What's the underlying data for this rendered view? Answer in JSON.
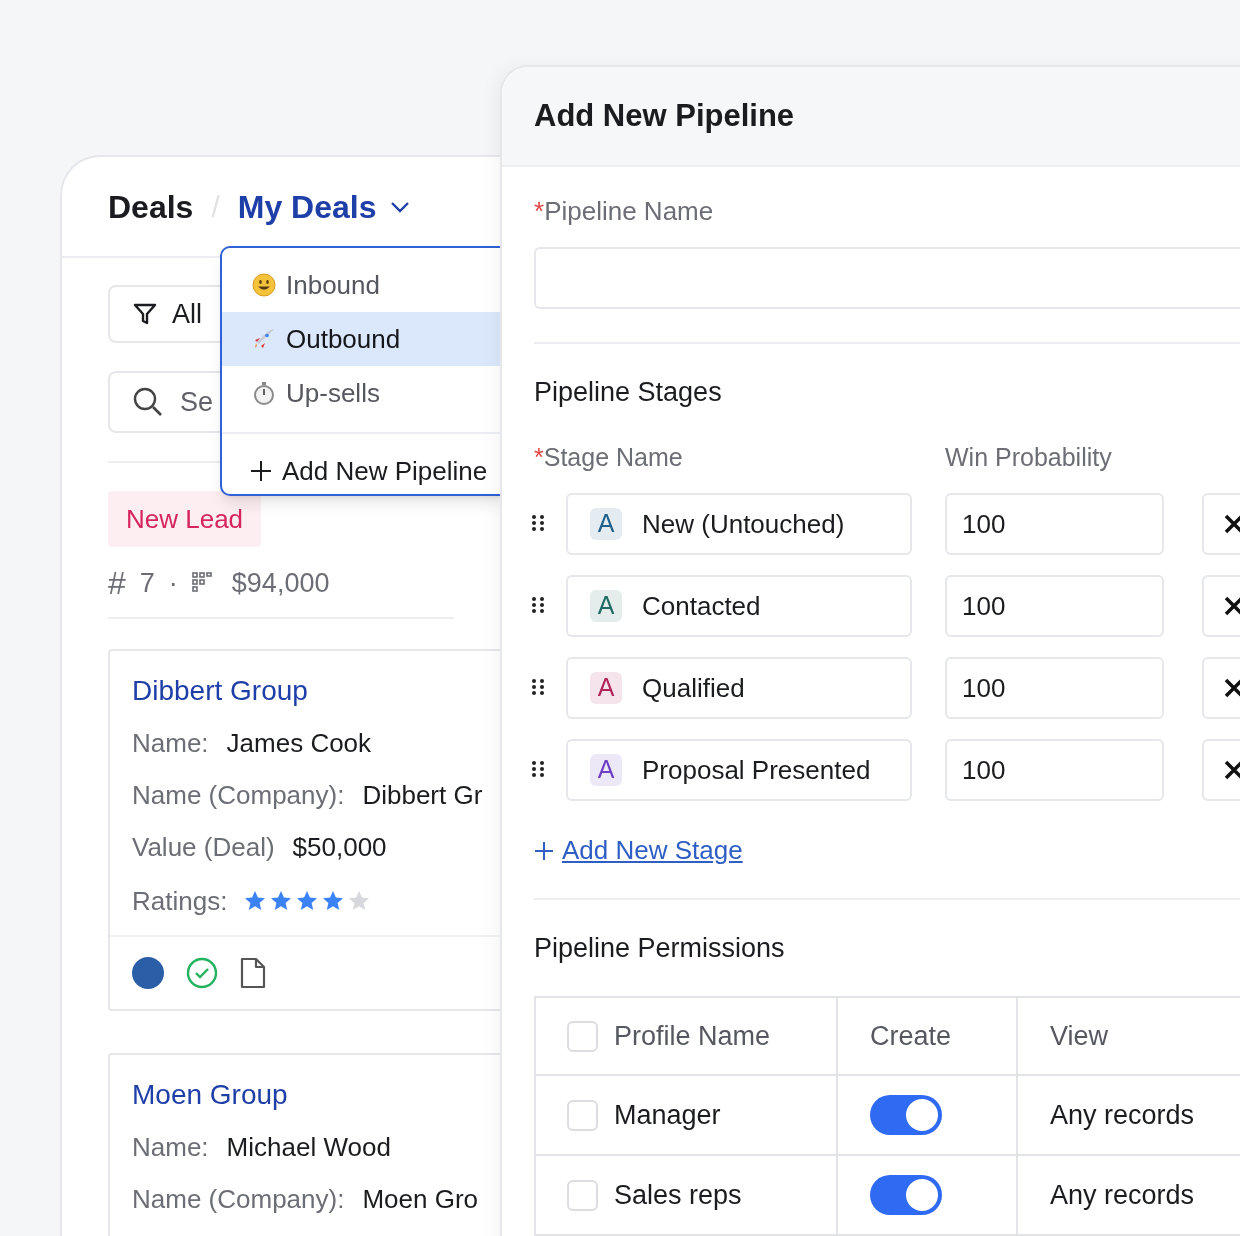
{
  "breadcrumb": {
    "root": "Deals",
    "separator": "/",
    "current": "My Deals"
  },
  "filter_button": {
    "label": "All"
  },
  "search": {
    "placeholder": "Se"
  },
  "pipeline_menu": {
    "items": [
      {
        "label": "Inbound",
        "selected": false,
        "kind": "smiley"
      },
      {
        "label": "Outbound",
        "selected": true,
        "kind": "rocket"
      },
      {
        "label": "Up-sells",
        "selected": false,
        "kind": "stopwatch"
      }
    ],
    "add_label": "Add New Pipeline"
  },
  "stage_group": {
    "tag": "New Lead",
    "count_symbol": "#",
    "count": "7",
    "separator": "·",
    "amount": "$94,000"
  },
  "deals": [
    {
      "company": "Dibbert Group",
      "fields": [
        {
          "label": "Name:",
          "value": "James Cook"
        },
        {
          "label": "Name (Company):",
          "value": "Dibbert Gr"
        },
        {
          "label": "Value (Deal)",
          "value": "$50,000"
        }
      ],
      "ratings_label": "Ratings:",
      "stars": 4
    },
    {
      "company": "Moen Group",
      "fields": [
        {
          "label": "Name:",
          "value": "Michael Wood"
        },
        {
          "label": "Name (Company):",
          "value": "Moen Gro"
        }
      ]
    }
  ],
  "dialog": {
    "title": "Add New Pipeline",
    "required_mark": "*",
    "name_label": "Pipeline Name",
    "stages_title": "Pipeline Stages",
    "stage_name_label": "Stage Name",
    "probability_label": "Win Probability",
    "stages": [
      {
        "initial": "A",
        "name": "New (Untouched)",
        "probability": "100",
        "color": "#1f5f8b"
      },
      {
        "initial": "A",
        "name": "Contacted",
        "probability": "100",
        "color": "#1d6b63"
      },
      {
        "initial": "A",
        "name": "Qualified",
        "probability": "100",
        "color": "#b0245a"
      },
      {
        "initial": "A",
        "name": "Proposal Presented",
        "probability": "100",
        "color": "#6b3fc4"
      }
    ],
    "add_stage": "Add New Stage",
    "permissions_title": "Pipeline Permissions",
    "permissions": {
      "header_checked": false,
      "columns": [
        "Profile Name",
        "Create",
        "View"
      ],
      "rows": [
        {
          "name": "Manager",
          "checked": false,
          "create_on": true,
          "view": "Any records"
        },
        {
          "name": "Sales reps",
          "checked": false,
          "create_on": true,
          "view": "Any records"
        }
      ]
    }
  }
}
